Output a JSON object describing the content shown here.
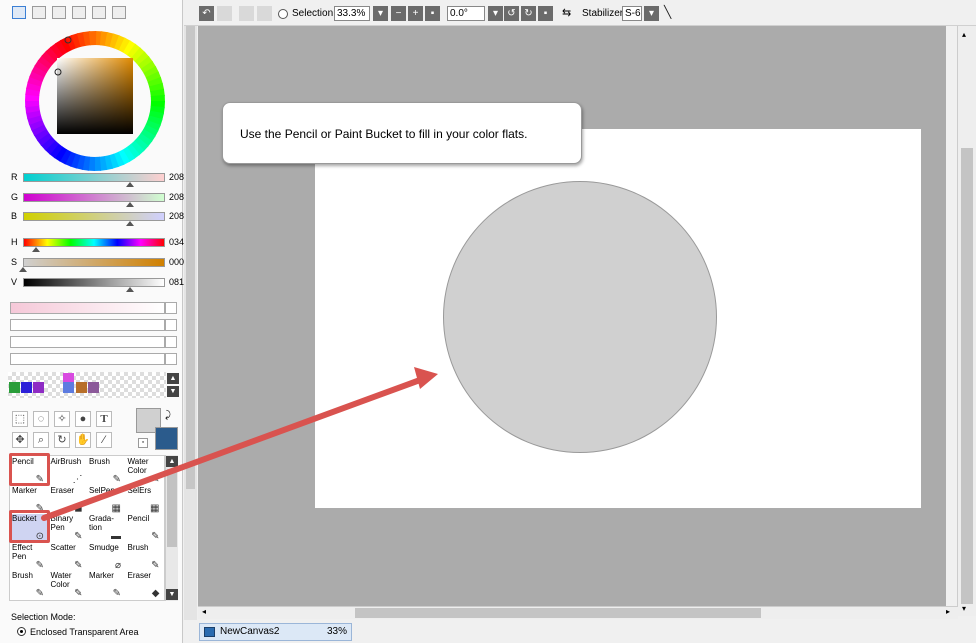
{
  "color_sliders": {
    "r": {
      "label": "R",
      "value": "208"
    },
    "g": {
      "label": "G",
      "value": "208"
    },
    "b": {
      "label": "B",
      "value": "208"
    },
    "h": {
      "label": "H",
      "value": "034"
    },
    "s": {
      "label": "S",
      "value": "000"
    },
    "v": {
      "label": "V",
      "value": "081"
    }
  },
  "palette_colors": [
    "#2a9d3a",
    "#2c1fd8",
    "#8e2bc4",
    "#d84ae0",
    "#5c7be0",
    "#b86f2a",
    "#8c5a9a"
  ],
  "primary_color": "#d0d0d0",
  "secondary_color": "#2b5b8c",
  "tools": {
    "text_tool": "T"
  },
  "brushes": [
    {
      "label": "Pencil"
    },
    {
      "label": "AirBrush"
    },
    {
      "label": "Brush"
    },
    {
      "label": "Water Color"
    },
    {
      "label": "Marker"
    },
    {
      "label": "Eraser"
    },
    {
      "label": "SelPen"
    },
    {
      "label": "SelErs"
    },
    {
      "label": "Bucket"
    },
    {
      "label": "Binary Pen"
    },
    {
      "label": "Grada- tion"
    },
    {
      "label": "Pencil"
    },
    {
      "label": "Effect Pen"
    },
    {
      "label": "Scatter"
    },
    {
      "label": "Smudge"
    },
    {
      "label": "Brush"
    },
    {
      "label": "Brush"
    },
    {
      "label": "Water Color"
    },
    {
      "label": "Marker"
    },
    {
      "label": "Eraser"
    }
  ],
  "selection_mode": {
    "label": "Selection Mode:",
    "option": "Enclosed Transparent Area"
  },
  "toolbar": {
    "selection_label": "Selection",
    "zoom": "33.3%",
    "rotation": "0.0°",
    "stabilizer_label": "Stabilizer",
    "stabilizer_value": "S-6"
  },
  "callout": {
    "text": "Use the Pencil or Paint Bucket to fill in your color flats."
  },
  "document_tab": {
    "name": "NewCanvas2",
    "zoom": "33%"
  },
  "colors": {
    "highlight": "#d9534f",
    "canvas_bg": "#ababab",
    "circle_fill": "#d0d0d0"
  }
}
